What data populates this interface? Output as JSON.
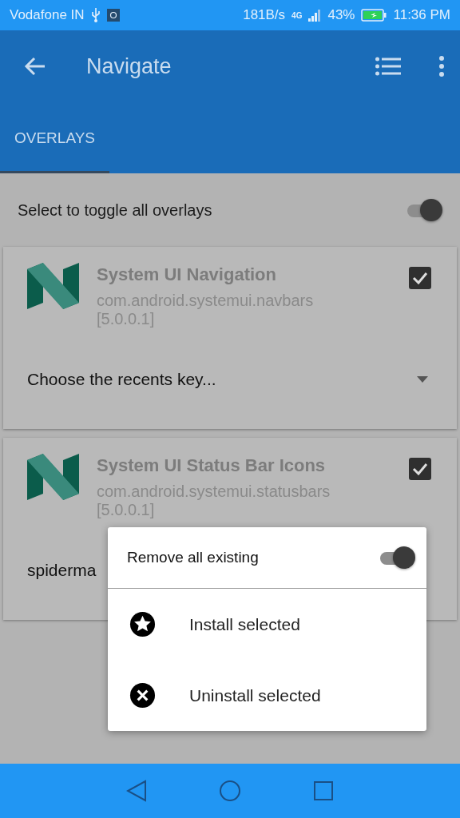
{
  "status_bar": {
    "carrier": "Vodafone IN",
    "speed": "181B/s",
    "network": "4G",
    "battery": "43%",
    "time": "11:36 PM"
  },
  "app_bar": {
    "title": "Navigate"
  },
  "tabs": [
    {
      "label": "OVERLAYS",
      "selected": true
    }
  ],
  "toggle_all": {
    "label": "Select to toggle all overlays",
    "on": true
  },
  "overlays": [
    {
      "name": "System UI Navigation",
      "package": "com.android.systemui.navbars",
      "version": "[5.0.0.1]",
      "checked": true,
      "option": "Choose the recents key..."
    },
    {
      "name": "System UI Status Bar Icons",
      "package": "com.android.systemui.statusbars",
      "version": "[5.0.0.1]",
      "checked": true,
      "option": "spiderma"
    }
  ],
  "dialog": {
    "toggle": {
      "label": "Remove all existing",
      "on": true
    },
    "actions": [
      {
        "kind": "install",
        "label": "Install selected"
      },
      {
        "kind": "uninstall",
        "label": "Uninstall selected"
      }
    ]
  }
}
